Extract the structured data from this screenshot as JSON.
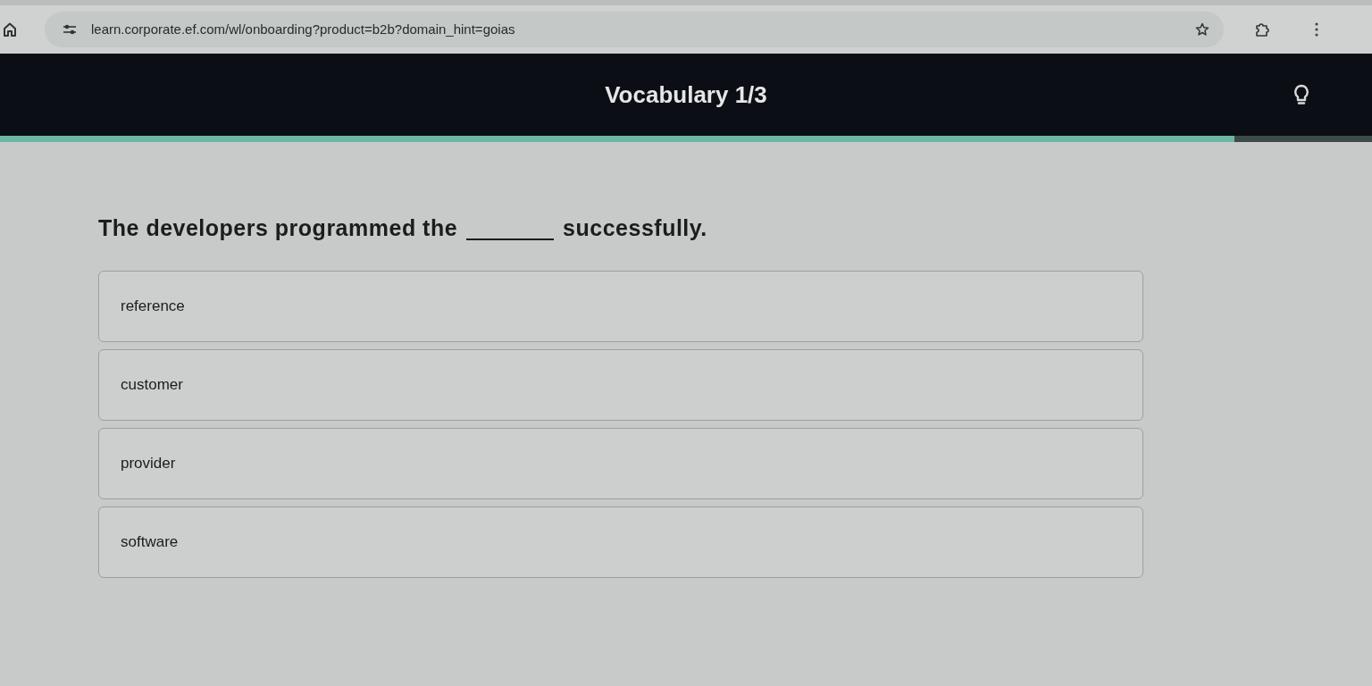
{
  "browser": {
    "url": "learn.corporate.ef.com/wl/onboarding?product=b2b?domain_hint=goias"
  },
  "header": {
    "title": "Vocabulary 1/3"
  },
  "progress": {
    "level": 0.9
  },
  "question": {
    "before": "The developers programmed the",
    "after": "successfully."
  },
  "options": [
    {
      "label": "reference",
      "selected": false
    },
    {
      "label": "customer",
      "selected": false
    },
    {
      "label": "provider",
      "selected": false
    },
    {
      "label": "software",
      "selected": false
    }
  ]
}
